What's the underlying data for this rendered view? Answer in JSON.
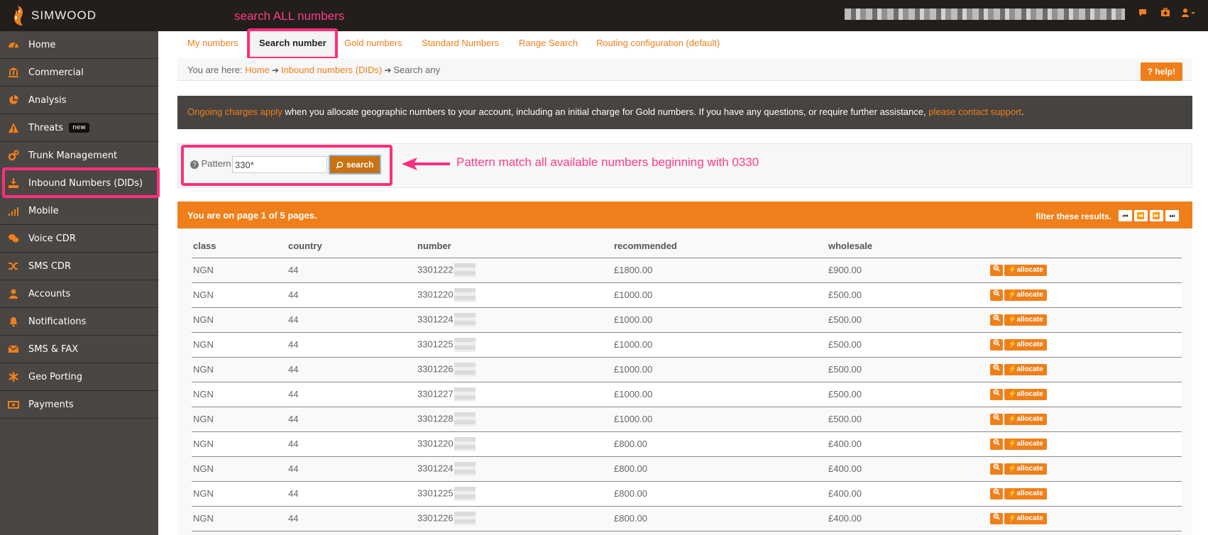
{
  "app": {
    "brand": "SIMWOOD"
  },
  "annotations": {
    "top": "search ALL numbers",
    "pattern": "Pattern match all available numbers beginning with 0330"
  },
  "sidebar": {
    "items": [
      {
        "label": "Home",
        "icon": "dashboard-icon"
      },
      {
        "label": "Commercial",
        "icon": "bank-icon"
      },
      {
        "label": "Analysis",
        "icon": "pie-chart-icon"
      },
      {
        "label": "Threats",
        "icon": "warning-icon",
        "badge": "new"
      },
      {
        "label": "Trunk Management",
        "icon": "cogs-icon"
      },
      {
        "label": "Inbound Numbers (DIDs)",
        "icon": "download-icon"
      },
      {
        "label": "Mobile",
        "icon": "signal-icon"
      },
      {
        "label": "Voice CDR",
        "icon": "comments-icon"
      },
      {
        "label": "SMS CDR",
        "icon": "random-icon"
      },
      {
        "label": "Accounts",
        "icon": "user-icon"
      },
      {
        "label": "Notifications",
        "icon": "bell-icon"
      },
      {
        "label": "SMS & FAX",
        "icon": "envelope-icon"
      },
      {
        "label": "Geo Porting",
        "icon": "asterisk-icon"
      },
      {
        "label": "Payments",
        "icon": "money-icon"
      }
    ]
  },
  "tabs": [
    {
      "label": "My numbers"
    },
    {
      "label": "Search number"
    },
    {
      "label": "Gold numbers"
    },
    {
      "label": "Standard Numbers"
    },
    {
      "label": "Range Search"
    },
    {
      "label": "Routing configuration (default)"
    }
  ],
  "breadcrumb": {
    "prefix": "You are here:",
    "home": "Home",
    "section": "Inbound numbers (DIDs)",
    "current": "Search any",
    "help": "help!"
  },
  "notice": {
    "link1": "Ongoing charges apply",
    "text1": " when you allocate geographic numbers to your account, including an initial charge for Gold numbers. If you have any questions, or require further assistance, ",
    "link2": "please contact support",
    "text2": "."
  },
  "search": {
    "label": "Pattern",
    "value": "330*",
    "button": "search"
  },
  "results": {
    "page_info": "You are on page 1 of 5 pages.",
    "filter": "filter these results.",
    "columns": [
      "class",
      "country",
      "number",
      "recommended",
      "wholesale"
    ],
    "allocate_label": "allocate",
    "rows": [
      {
        "class": "NGN",
        "country": "44",
        "number": "3301222",
        "recommended": "£1800.00",
        "wholesale": "£900.00"
      },
      {
        "class": "NGN",
        "country": "44",
        "number": "3301220",
        "recommended": "£1000.00",
        "wholesale": "£500.00"
      },
      {
        "class": "NGN",
        "country": "44",
        "number": "3301224",
        "recommended": "£1000.00",
        "wholesale": "£500.00"
      },
      {
        "class": "NGN",
        "country": "44",
        "number": "3301225",
        "recommended": "£1000.00",
        "wholesale": "£500.00"
      },
      {
        "class": "NGN",
        "country": "44",
        "number": "3301226",
        "recommended": "£1000.00",
        "wholesale": "£500.00"
      },
      {
        "class": "NGN",
        "country": "44",
        "number": "3301227",
        "recommended": "£1000.00",
        "wholesale": "£500.00"
      },
      {
        "class": "NGN",
        "country": "44",
        "number": "3301228",
        "recommended": "£1000.00",
        "wholesale": "£500.00"
      },
      {
        "class": "NGN",
        "country": "44",
        "number": "3301220",
        "recommended": "£800.00",
        "wholesale": "£400.00"
      },
      {
        "class": "NGN",
        "country": "44",
        "number": "3301224",
        "recommended": "£800.00",
        "wholesale": "£400.00"
      },
      {
        "class": "NGN",
        "country": "44",
        "number": "3301225",
        "recommended": "£800.00",
        "wholesale": "£400.00"
      },
      {
        "class": "NGN",
        "country": "44",
        "number": "3301226",
        "recommended": "£800.00",
        "wholesale": "£400.00"
      }
    ]
  },
  "colors": {
    "accent": "#ef7f1a",
    "sidebar": "#4a4644",
    "topbar": "#221e1c",
    "highlight": "#ff2e7c"
  }
}
